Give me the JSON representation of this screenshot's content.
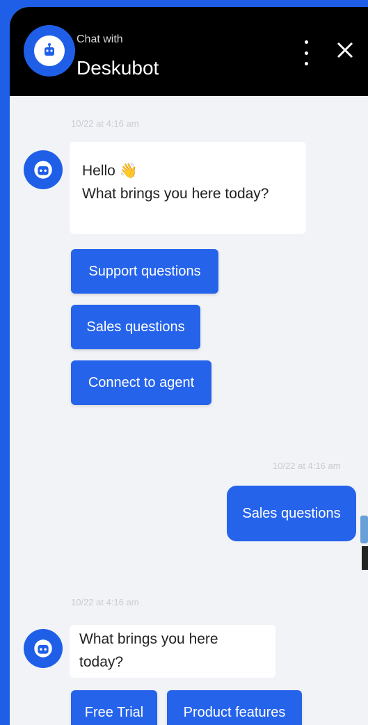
{
  "header": {
    "subtitle": "Chat with",
    "title": "Deskubot",
    "menu_icon": "more-vertical-icon",
    "close_icon": "close-icon"
  },
  "messages": {
    "first_time": "10/22 at 4:16 am",
    "first_greeting": "Hello 👋",
    "first_question": "What brings you here today?",
    "options": [
      "Support questions",
      "Sales questions",
      "Connect to agent"
    ],
    "user_time": "10/22 at 4:16 am",
    "user_reply": "Sales questions",
    "second_time": "10/22 at 4:16 am",
    "second_question": "What brings you here today?",
    "second_options": [
      "Free Trial",
      "Product features"
    ]
  },
  "colors": {
    "accent": "#2563eb",
    "frame": "#1f5fe8",
    "header_bg": "#000000",
    "panel_bg": "#f2f3f6"
  }
}
